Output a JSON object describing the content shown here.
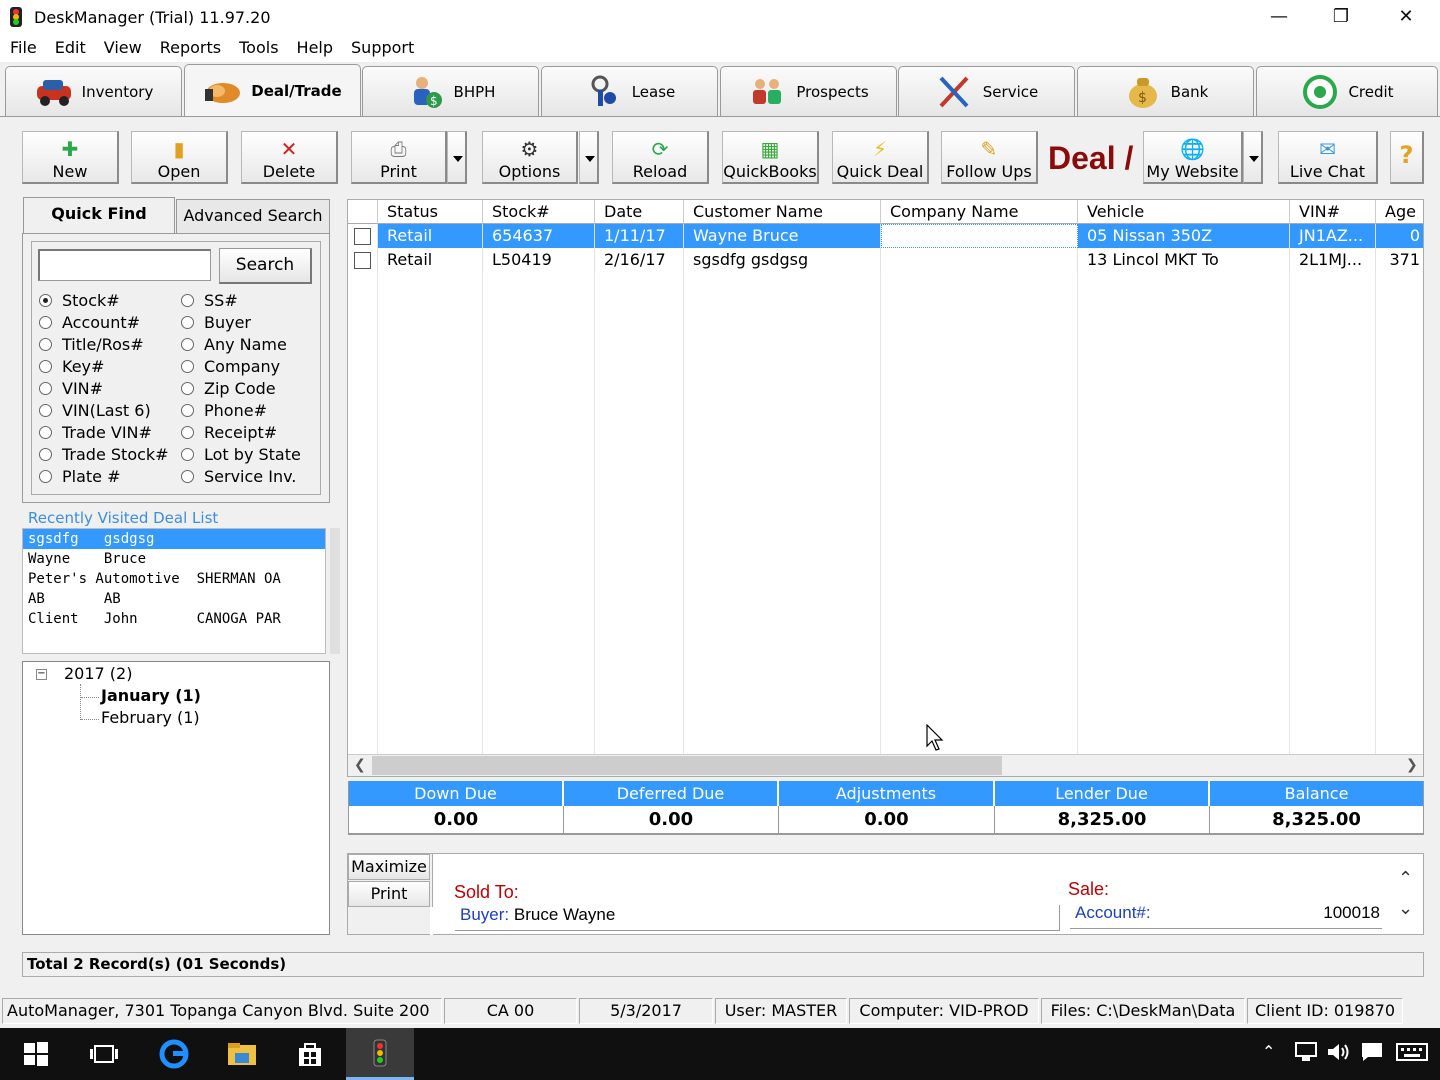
{
  "window": {
    "title": "DeskManager (Trial) 11.97.20"
  },
  "menu": [
    "File",
    "Edit",
    "View",
    "Reports",
    "Tools",
    "Help",
    "Support"
  ],
  "main_tabs": [
    {
      "label": "Inventory",
      "icon": "car-icon"
    },
    {
      "label": "Deal/Trade",
      "icon": "handshake-icon"
    },
    {
      "label": "BHPH",
      "icon": "person-dollar-icon"
    },
    {
      "label": "Lease",
      "icon": "keys-icon"
    },
    {
      "label": "Prospects",
      "icon": "people-icon"
    },
    {
      "label": "Service",
      "icon": "tools-icon"
    },
    {
      "label": "Bank",
      "icon": "money-bag-icon"
    },
    {
      "label": "Credit",
      "icon": "credit-gauge-icon"
    }
  ],
  "toolbar": {
    "new": "New",
    "open": "Open",
    "delete": "Delete",
    "print": "Print",
    "options": "Options",
    "reload": "Reload",
    "quickbooks": "QuickBooks",
    "quick_deal": "Quick Deal",
    "follow_ups": "Follow Ups",
    "deal_logo": "Deal /",
    "my_website": "My Website",
    "live_chat": "Live Chat",
    "help": "?"
  },
  "quick_find": {
    "tab_quick": "Quick Find",
    "tab_advanced": "Advanced Search",
    "search_button": "Search",
    "search_value": "",
    "selected": "Stock#",
    "left_options": [
      "Stock#",
      "Account#",
      "Title/Ros#",
      "Key#",
      "VIN#",
      "VIN(Last 6)",
      "Trade VIN#",
      "Trade Stock#",
      "Plate #"
    ],
    "right_options": [
      "SS#",
      "Buyer",
      "Any Name",
      "Company",
      "Zip Code",
      "Phone#",
      "Receipt#",
      "Lot by State",
      "Service Inv."
    ]
  },
  "recent": {
    "title": "Recently Visited Deal List",
    "rows": [
      "sgsdfg   gsdgsg",
      "Wayne    Bruce",
      "Peter's Automotive  SHERMAN OA",
      "AB       AB",
      "Client   John       CANOGA PAR"
    ]
  },
  "tree": {
    "year": "2017 (2)",
    "months": [
      "January (1)",
      "February (1)"
    ]
  },
  "grid": {
    "columns": [
      "Status",
      "Stock#",
      "Date",
      "Customer Name",
      "Company Name",
      "Vehicle",
      "VIN#",
      "Age"
    ],
    "rows": [
      {
        "status": "Retail",
        "stock": "654637",
        "date": "1/11/17",
        "customer": "Wayne Bruce",
        "company": "",
        "vehicle": "05 Nissan 350Z",
        "vin": "JN1AZ...",
        "age": "0"
      },
      {
        "status": "Retail",
        "stock": "L50419",
        "date": "2/16/17",
        "customer": "sgsdfg gsdgsg",
        "company": "",
        "vehicle": "13 Lincol MKT To",
        "vin": "2L1MJ...",
        "age": "371"
      }
    ]
  },
  "summary": [
    {
      "label": "Down Due",
      "value": "0.00"
    },
    {
      "label": "Deferred Due",
      "value": "0.00"
    },
    {
      "label": "Adjustments",
      "value": "0.00"
    },
    {
      "label": "Lender Due",
      "value": "8,325.00"
    },
    {
      "label": "Balance",
      "value": "8,325.00"
    }
  ],
  "detail": {
    "maximize": "Maximize",
    "print": "Print",
    "sold_to": "Sold To:",
    "buyer_label": "Buyer:",
    "buyer_value": "Bruce Wayne",
    "sale": "Sale:",
    "account_label": "Account#:",
    "account_value": "100018"
  },
  "status_line": "Total 2 Record(s) (01 Seconds)",
  "statusbar": [
    "AutoManager, 7301 Topanga Canyon Blvd. Suite 200",
    "CA 00",
    "5/3/2017",
    "User: MASTER",
    "Computer: VID-PROD",
    "Files: C:\\DeskMan\\Data",
    "Client ID: 019870"
  ],
  "colors": {
    "accent": "#3399ff",
    "deal_red": "#8b0b0b",
    "sold_red": "#c00000",
    "label_blue": "#1a3fbf"
  }
}
